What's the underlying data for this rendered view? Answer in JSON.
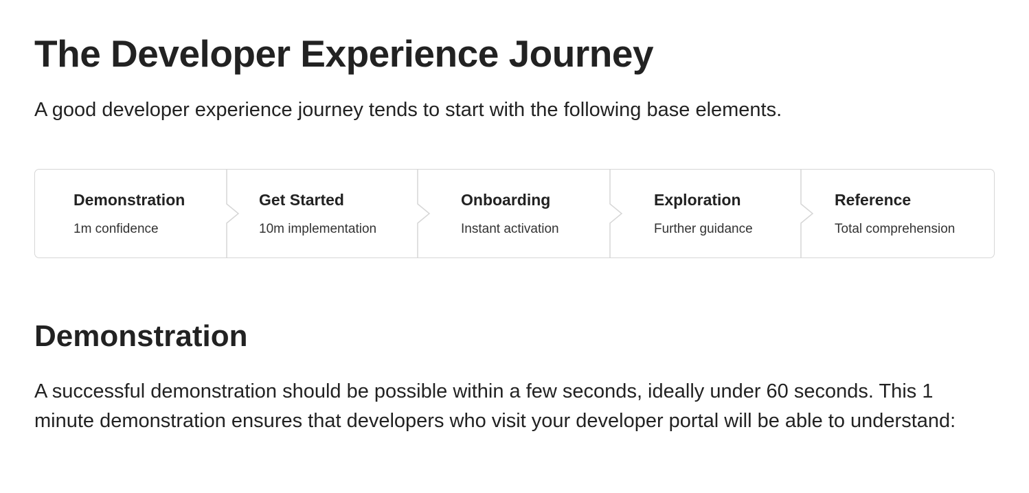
{
  "header": {
    "title": "The Developer Experience Journey",
    "intro": "A good developer experience journey tends to start with the following base elements."
  },
  "journey": {
    "steps": [
      {
        "title": "Demonstration",
        "subtitle": "1m confidence"
      },
      {
        "title": "Get Started",
        "subtitle": "10m implementation"
      },
      {
        "title": "Onboarding",
        "subtitle": "Instant activation"
      },
      {
        "title": "Exploration",
        "subtitle": "Further guidance"
      },
      {
        "title": "Reference",
        "subtitle": "Total comprehension"
      }
    ]
  },
  "section": {
    "title": "Demonstration",
    "body": "A successful demonstration should be possible within a few seconds, ideally under 60 seconds. This 1 minute demonstration ensures that developers who visit your developer portal will be able to understand:"
  },
  "colors": {
    "text": "#222222",
    "border": "#d6d6d6",
    "background": "#ffffff"
  }
}
